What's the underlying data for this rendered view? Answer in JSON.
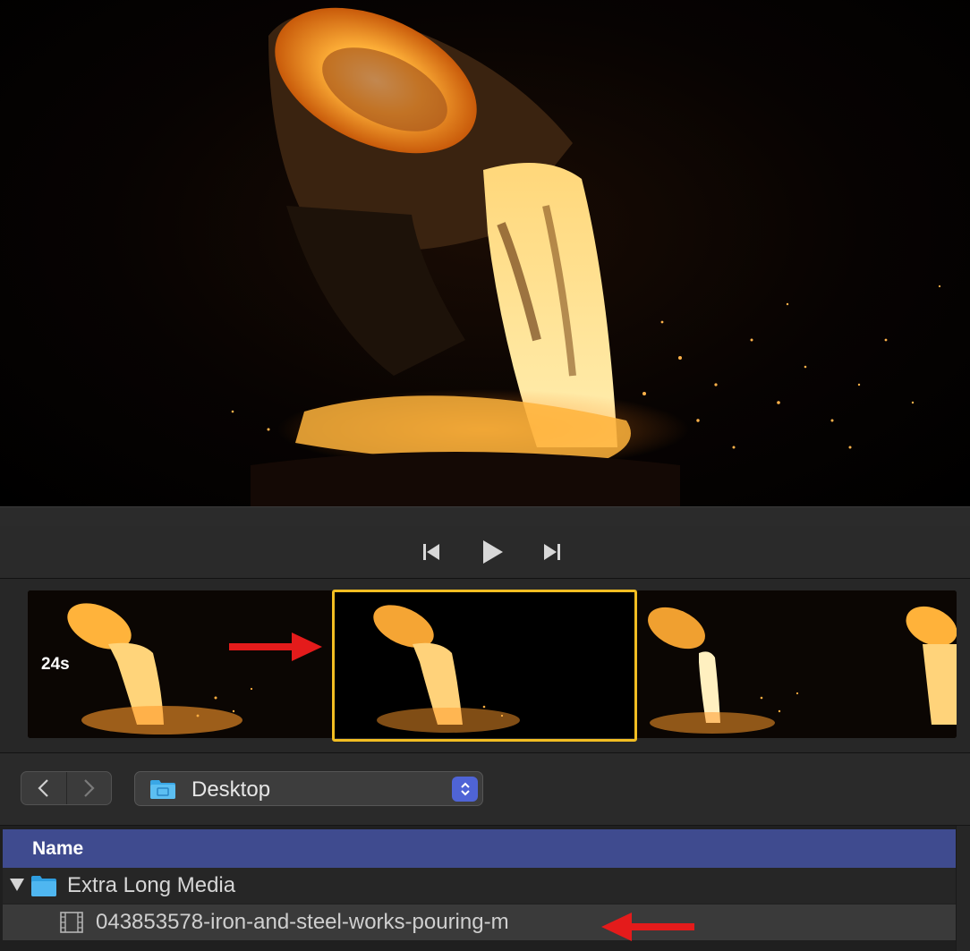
{
  "transport": {
    "previous_icon": "skip-to-start-icon",
    "play_icon": "play-icon",
    "next_icon": "skip-to-end-icon"
  },
  "filmstrip": {
    "duration_label": "24s",
    "selected_frame_index": 1,
    "frame_count": 3
  },
  "navigation": {
    "back_icon": "chevron-left-icon",
    "forward_icon": "chevron-right-icon",
    "location": "Desktop",
    "location_icon": "desktop-folder-icon",
    "stepper_icon": "up-down-chevron-icon"
  },
  "browser": {
    "column_name": "Name",
    "folder": {
      "name": "Extra Long Media",
      "icon": "folder-icon",
      "expanded": true
    },
    "file": {
      "name": "043853578-iron-and-steel-works-pouring-m",
      "icon": "film-icon"
    }
  },
  "colors": {
    "selection": "#f2be22",
    "header": "#3f4b8f",
    "accent": "#4f64d6",
    "annotation_arrow": "#e41b1b"
  }
}
